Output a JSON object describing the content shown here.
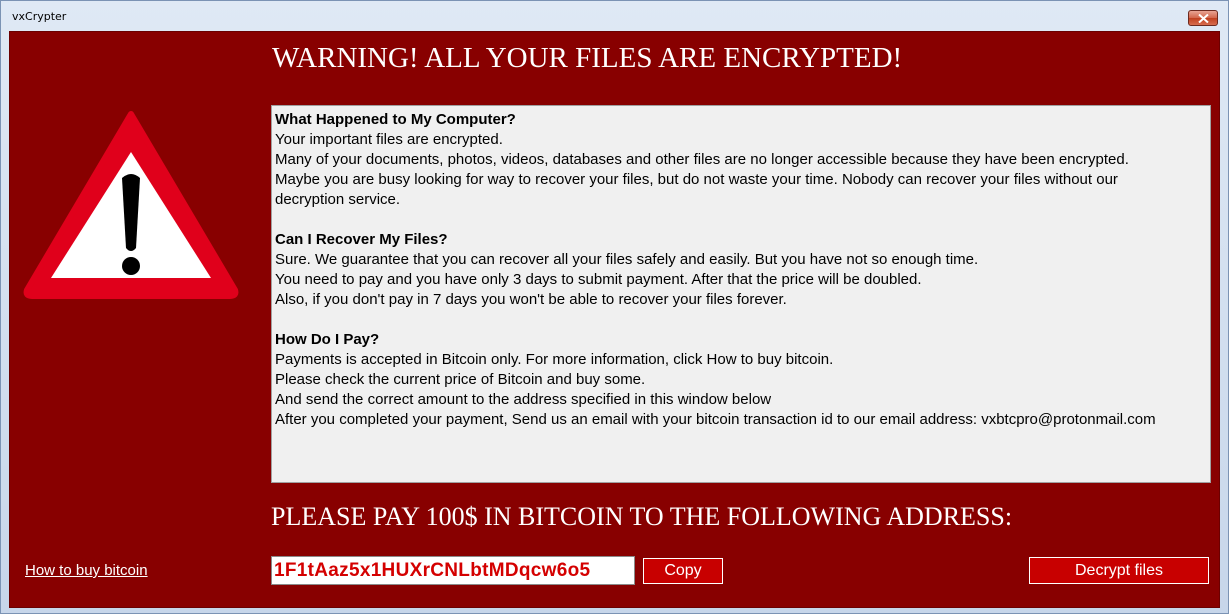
{
  "window": {
    "title": "vxCrypter"
  },
  "main": {
    "warning_heading": "WARNING! ALL YOUR FILES ARE ENCRYPTED!",
    "sections": [
      {
        "question": "What Happened to My Computer?",
        "lines": [
          "Your important files are encrypted.",
          "Many of your documents, photos, videos, databases and other files are no longer accessible because they have been encrypted.",
          "Maybe you are busy looking for way to recover your files, but do not waste your time. Nobody can recover your files without our",
          "decryption service."
        ]
      },
      {
        "question": "Can I Recover My Files?",
        "lines": [
          "Sure. We guarantee that you can recover all your files safely and easily. But you have not so enough time.",
          "You need to pay and you have only 3 days to submit payment. After that the price will be doubled.",
          "Also, if you don't pay in 7 days you won't be able to recover your files forever."
        ]
      },
      {
        "question": "How Do I Pay?",
        "lines": [
          "Payments is accepted in Bitcoin only. For more information, click How to buy bitcoin.",
          "Please check the current price of Bitcoin and buy some.",
          "And send the correct amount to the address specified in this window below",
          "After you completed your payment, Send us an email with your bitcoin transaction id to our email address: vxbtcpro@protonmail.com"
        ]
      }
    ],
    "pay_heading": "PLEASE PAY 100$ IN BITCOIN TO THE FOLLOWING ADDRESS:"
  },
  "footer": {
    "how_to_buy_link": "How to buy bitcoin",
    "bitcoin_address": "1F1tAaz5x1HUXrCNLbtMDqcw6o5",
    "copy_label": "Copy",
    "decrypt_label": "Decrypt files"
  },
  "icons": {
    "close": "close-icon",
    "warning": "warning-triangle-icon"
  },
  "colors": {
    "background": "#880000",
    "button": "#c80000",
    "address_text": "#d40000",
    "triangle_red": "#e0001b"
  }
}
